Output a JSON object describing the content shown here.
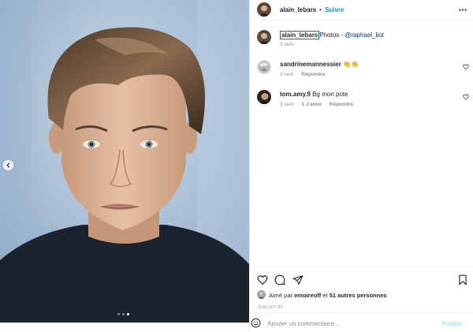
{
  "post": {
    "author": "alain_lebars",
    "separator": "•",
    "follow_label": "Suivre",
    "caption": {
      "username": "alain_lebars",
      "text": "Photos - ",
      "mention": "@raphael_liot",
      "time": "3 sem"
    },
    "comments": [
      {
        "username": "sandrinemannessier",
        "text": "👏👏",
        "time": "3 sem",
        "likes": "",
        "reply_label": "Répondre"
      },
      {
        "username": "tom.amy.9",
        "text": "Bg mon pote",
        "time": "3 sem",
        "likes": "1 J'aime",
        "reply_label": "Répondre"
      }
    ],
    "liked_by": {
      "prefix": "Aimé par",
      "user": "emoireoff",
      "conj": "et",
      "others": "51 autres personnes"
    },
    "date": "JUILLET 30",
    "comment_placeholder": "Ajouter un commentaire...",
    "publish_label": "Publier"
  },
  "carousel": {
    "total": 3,
    "current": 3
  },
  "icons": [
    "chevron-left-icon",
    "more-icon",
    "heart-icon",
    "comment-icon",
    "share-icon",
    "bookmark-icon",
    "emoji-icon"
  ],
  "colors": {
    "link": "#0095f6",
    "mention": "#00376b",
    "muted": "#8e8e8e",
    "publish_disabled": "#b2dffc"
  }
}
